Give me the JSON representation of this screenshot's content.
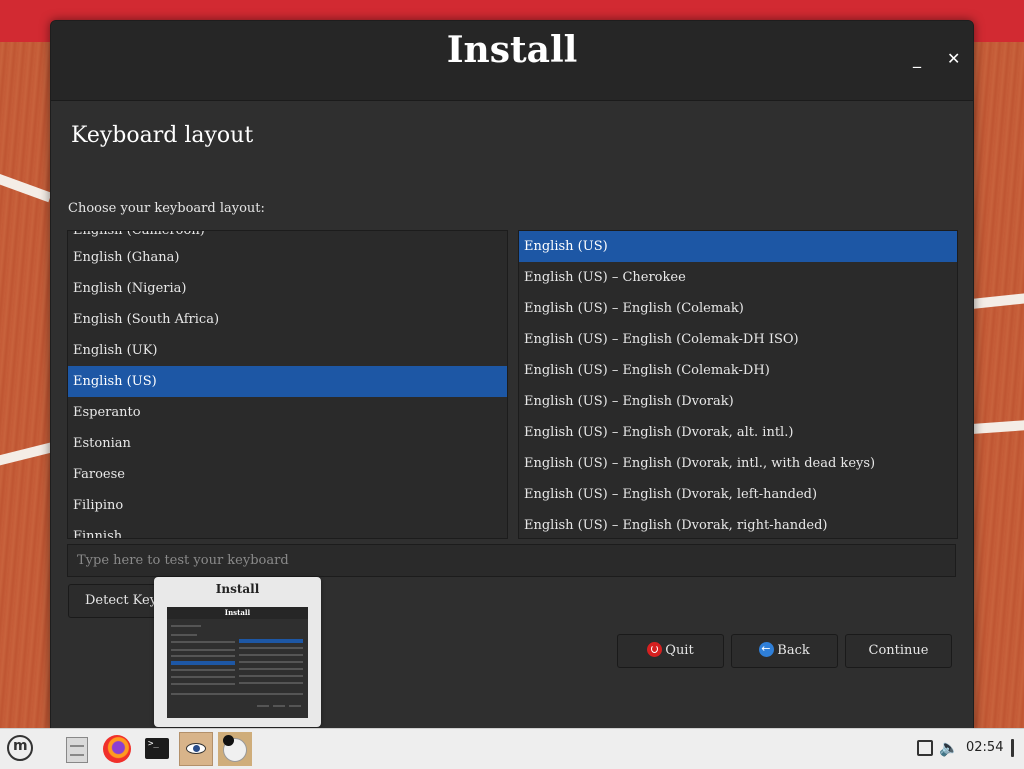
{
  "window": {
    "title": "Install",
    "minimize_glyph": "_",
    "close_glyph": "✕"
  },
  "page": {
    "title": "Keyboard layout",
    "choose_label": "Choose your keyboard layout:"
  },
  "layouts": [
    {
      "label": "English (Ghana)",
      "selected": false
    },
    {
      "label": "English (Nigeria)",
      "selected": false
    },
    {
      "label": "English (South Africa)",
      "selected": false
    },
    {
      "label": "English (UK)",
      "selected": false
    },
    {
      "label": "English (US)",
      "selected": true
    },
    {
      "label": "Esperanto",
      "selected": false
    },
    {
      "label": "Estonian",
      "selected": false
    },
    {
      "label": "Faroese",
      "selected": false
    },
    {
      "label": "Filipino",
      "selected": false
    },
    {
      "label": "Finnish",
      "selected": false
    }
  ],
  "variants": [
    {
      "label": "English (US)",
      "selected": true
    },
    {
      "label": "English (US) – Cherokee",
      "selected": false
    },
    {
      "label": "English (US) – English (Colemak)",
      "selected": false
    },
    {
      "label": "English (US) – English (Colemak-DH ISO)",
      "selected": false
    },
    {
      "label": "English (US) – English (Colemak-DH)",
      "selected": false
    },
    {
      "label": "English (US) – English (Dvorak)",
      "selected": false
    },
    {
      "label": "English (US) – English (Dvorak, alt. intl.)",
      "selected": false
    },
    {
      "label": "English (US) – English (Dvorak, intl., with dead keys)",
      "selected": false
    },
    {
      "label": "English (US) – English (Dvorak, left-handed)",
      "selected": false
    },
    {
      "label": "English (US) – English (Dvorak, right-handed)",
      "selected": false
    }
  ],
  "test_field": {
    "placeholder": "Type here to test your keyboard",
    "value": ""
  },
  "buttons": {
    "detect": "Detect Keyb",
    "quit": "Quit",
    "back": "Back",
    "continue": "Continue"
  },
  "thumbnail": {
    "title": "Install",
    "preview_title": "Install"
  },
  "taskbar": {
    "clock": "02:54",
    "icons": [
      "mint-menu-icon",
      "file-cabinet-icon",
      "firefox-icon",
      "terminal-icon",
      "installer-eye-icon",
      "app-icon"
    ]
  },
  "colors": {
    "selection": "#1d57a5",
    "window_bg": "#2f2f2f",
    "titlebar_bg": "#262626",
    "quit_icon": "#d62020",
    "back_icon": "#2f7fd8"
  }
}
